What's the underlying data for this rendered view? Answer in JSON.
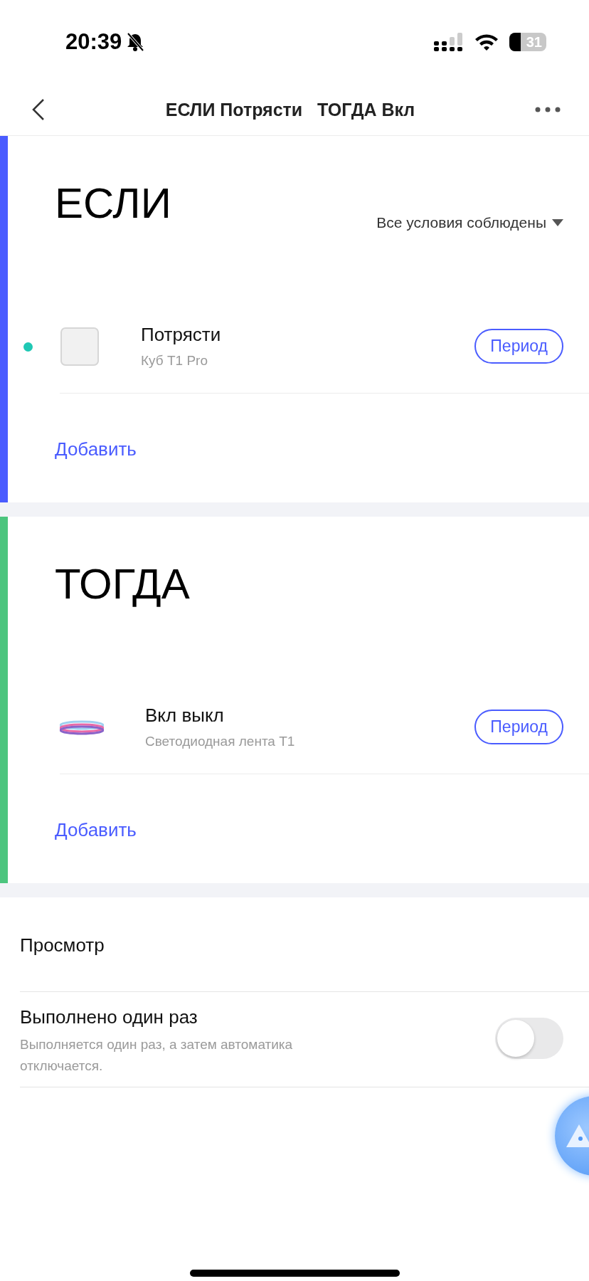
{
  "status_bar": {
    "time": "20:39",
    "battery": "31"
  },
  "header": {
    "title": "ЕСЛИ Потрясти   ТОГДА Вкл"
  },
  "sections": [
    {
      "heading": "ЕСЛИ",
      "color": "#4a5cff",
      "condition_mode": "Все условия соблюдены",
      "items": [
        {
          "title": "Потрясти",
          "subtitle": "Куб T1 Pro",
          "kind": "cube",
          "online": true,
          "button": "Период"
        }
      ],
      "add": "Добавить"
    },
    {
      "heading": "ТОГДА",
      "color": "#4cc57e",
      "items": [
        {
          "title": "Вкл выкл",
          "subtitle": "Светодиодная лента T1",
          "kind": "strip",
          "online": false,
          "button": "Период"
        }
      ],
      "add": "Добавить"
    }
  ],
  "options": {
    "preview": {
      "label": "Просмотр"
    },
    "run_once": {
      "title": "Выполнено один раз",
      "description": "Выполняется один раз, а затем автоматика отключается.",
      "on": false
    }
  }
}
